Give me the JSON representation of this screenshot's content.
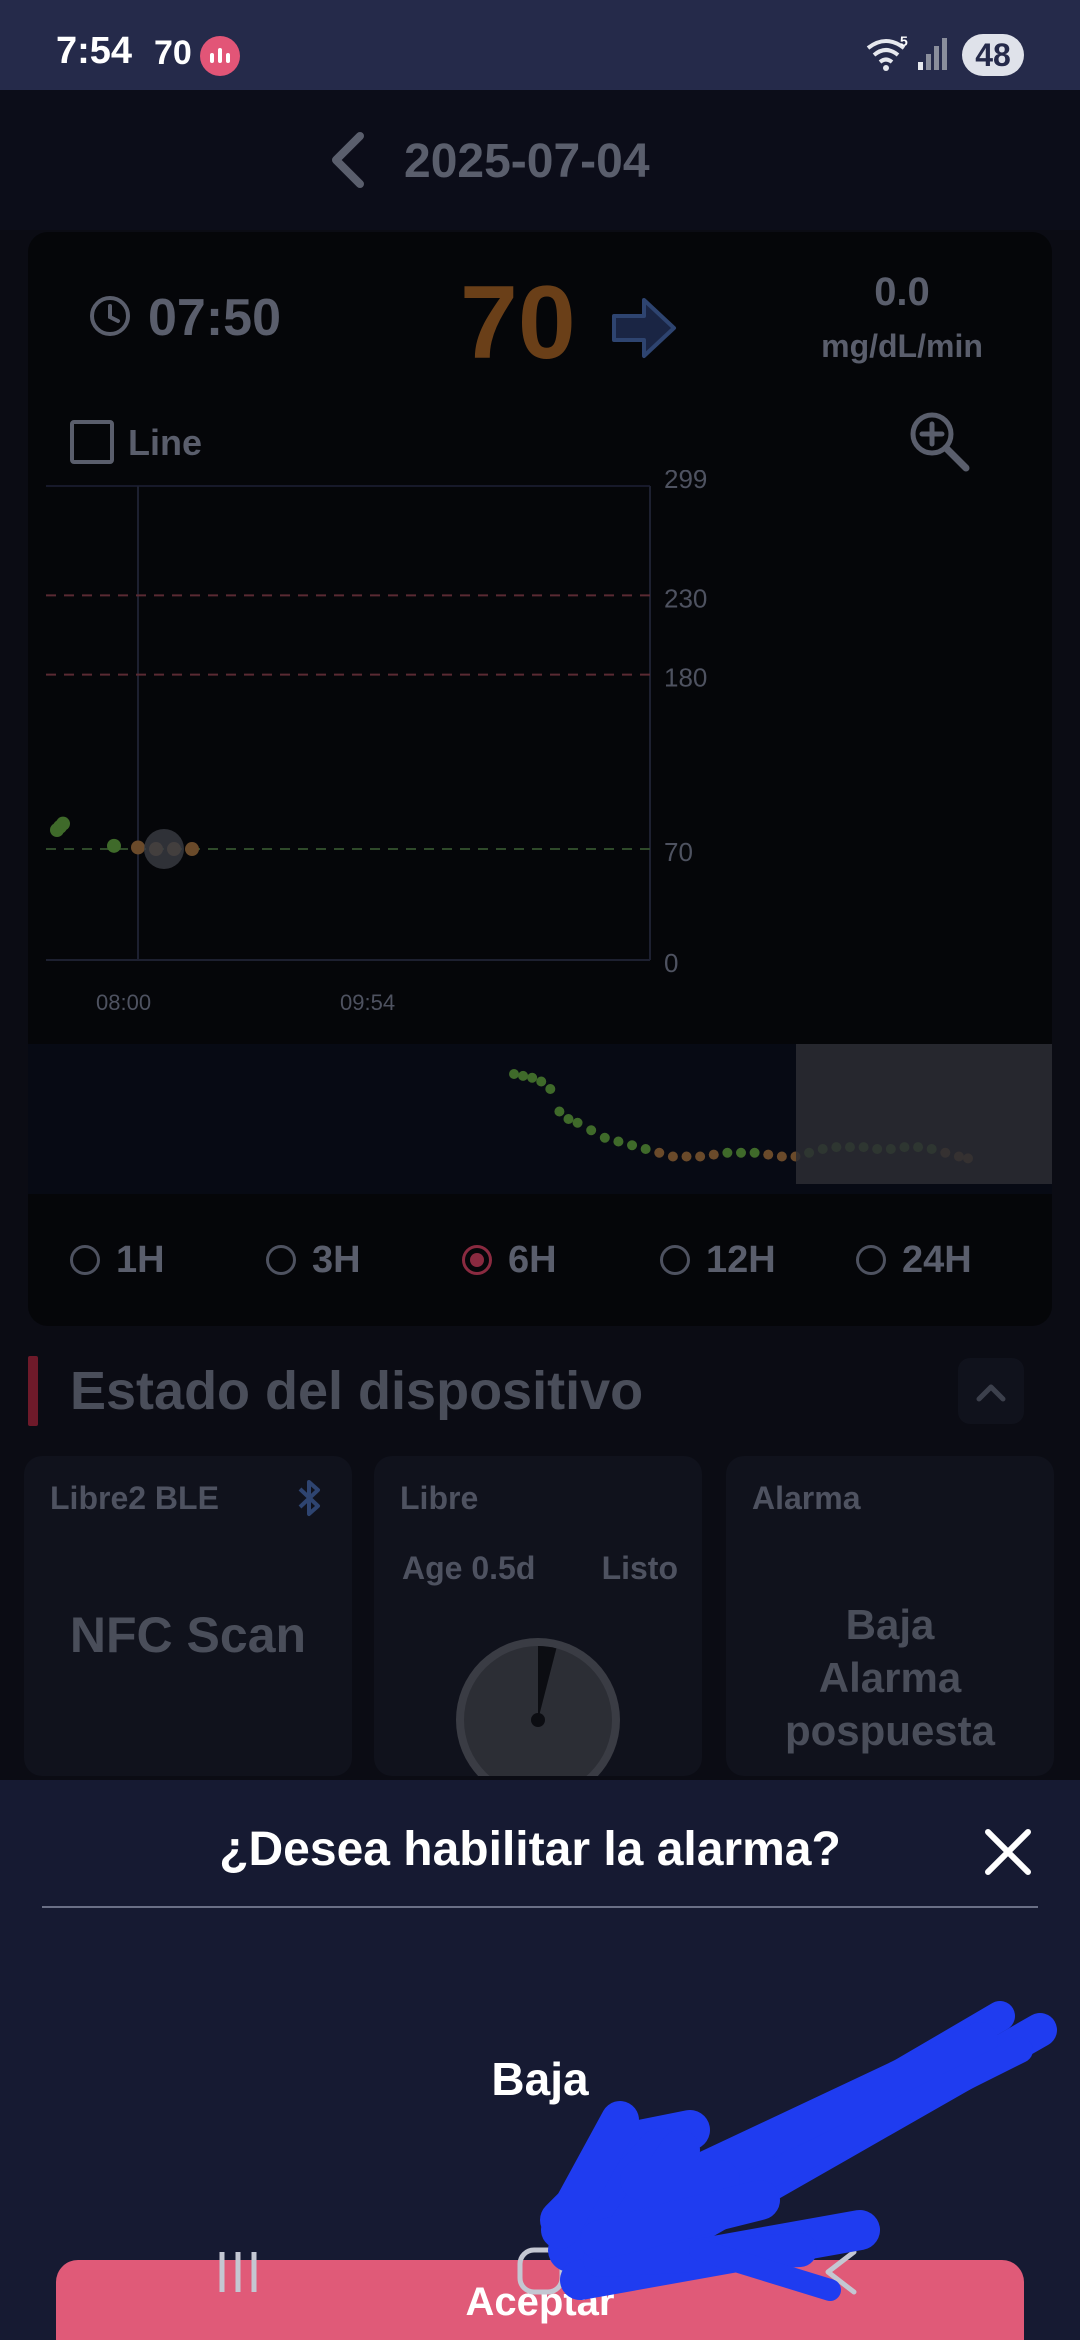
{
  "status_bar": {
    "time": "7:54",
    "glucose": "70",
    "battery": "48",
    "wifi_badge": "5",
    "icons": [
      "app-notification-icon",
      "wifi-icon",
      "signal-icon",
      "battery-icon"
    ]
  },
  "header": {
    "date": "2025-07-04",
    "back_icon": "chevron-left-icon"
  },
  "reading": {
    "time": "07:50",
    "value": "70",
    "value_color": "#6a3f18",
    "trend": "arrow-right",
    "rate": "0.0",
    "rate_unit": "mg/dL/min"
  },
  "chart_options": {
    "line_label": "Line",
    "line_checked": false
  },
  "chart_data": [
    {
      "type": "scatter",
      "x_tick_labels": [
        "08:00",
        "09:54"
      ],
      "y_tick_labels": [
        "299",
        "230",
        "180",
        "70",
        "0"
      ],
      "ylim": [
        0,
        299
      ],
      "thresholds": [
        {
          "value": 230,
          "color": "#5a2a33",
          "style": "dashed"
        },
        {
          "value": 180,
          "color": "#5a2a33",
          "style": "dashed"
        },
        {
          "value": 70,
          "color": "#2f4a2a",
          "style": "dashed"
        }
      ],
      "cursor_value": 70,
      "points": [
        {
          "x": -0.135,
          "y": 82,
          "color": "#3f6a2a"
        },
        {
          "x": -0.13,
          "y": 84,
          "color": "#3f6a2a"
        },
        {
          "x": -0.125,
          "y": 86,
          "color": "#3f6a2a"
        },
        {
          "x": -0.04,
          "y": 72,
          "color": "#3f6a2a"
        },
        {
          "x": 0.0,
          "y": 71,
          "color": "#6a4a2a"
        },
        {
          "x": 0.03,
          "y": 70,
          "color": "#6a4a2a"
        },
        {
          "x": 0.06,
          "y": 70,
          "color": "#6a4a2a"
        },
        {
          "x": 0.09,
          "y": 70,
          "color": "#6a4a2a"
        }
      ],
      "grid": false
    },
    {
      "type": "scatter",
      "role": "overview",
      "ylim": [
        0,
        299
      ],
      "points": [
        {
          "x": 0.0,
          "y": 124,
          "color": "#3f6a2a"
        },
        {
          "x": 0.02,
          "y": 123,
          "color": "#3f6a2a"
        },
        {
          "x": 0.04,
          "y": 122,
          "color": "#3f6a2a"
        },
        {
          "x": 0.06,
          "y": 120,
          "color": "#3f6a2a"
        },
        {
          "x": 0.08,
          "y": 116,
          "color": "#3f6a2a"
        },
        {
          "x": 0.1,
          "y": 104,
          "color": "#3f6a2a"
        },
        {
          "x": 0.12,
          "y": 100,
          "color": "#3f6a2a"
        },
        {
          "x": 0.14,
          "y": 98,
          "color": "#3f6a2a"
        },
        {
          "x": 0.17,
          "y": 94,
          "color": "#3f6a2a"
        },
        {
          "x": 0.2,
          "y": 90,
          "color": "#3f6a2a"
        },
        {
          "x": 0.23,
          "y": 88,
          "color": "#3f6a2a"
        },
        {
          "x": 0.26,
          "y": 86,
          "color": "#3f6a2a"
        },
        {
          "x": 0.29,
          "y": 84,
          "color": "#3f6a2a"
        },
        {
          "x": 0.32,
          "y": 82,
          "color": "#6a4a2a"
        },
        {
          "x": 0.35,
          "y": 80,
          "color": "#6a4a2a"
        },
        {
          "x": 0.38,
          "y": 80,
          "color": "#6a4a2a"
        },
        {
          "x": 0.41,
          "y": 80,
          "color": "#6a4a2a"
        },
        {
          "x": 0.44,
          "y": 81,
          "color": "#6a4a2a"
        },
        {
          "x": 0.47,
          "y": 82,
          "color": "#3f6a2a"
        },
        {
          "x": 0.5,
          "y": 82,
          "color": "#3f6a2a"
        },
        {
          "x": 0.53,
          "y": 82,
          "color": "#3f6a2a"
        },
        {
          "x": 0.56,
          "y": 81,
          "color": "#6a4a2a"
        },
        {
          "x": 0.59,
          "y": 80,
          "color": "#6a4a2a"
        },
        {
          "x": 0.62,
          "y": 80,
          "color": "#6a4a2a"
        },
        {
          "x": 0.65,
          "y": 82,
          "color": "#3f6a2a"
        },
        {
          "x": 0.68,
          "y": 84,
          "color": "#3f6a2a"
        },
        {
          "x": 0.71,
          "y": 85,
          "color": "#3f6a2a"
        },
        {
          "x": 0.74,
          "y": 85,
          "color": "#3f6a2a"
        },
        {
          "x": 0.77,
          "y": 85,
          "color": "#3f6a2a"
        },
        {
          "x": 0.8,
          "y": 84,
          "color": "#3f6a2a"
        },
        {
          "x": 0.83,
          "y": 84,
          "color": "#3f6a2a"
        },
        {
          "x": 0.86,
          "y": 85,
          "color": "#3f6a2a"
        },
        {
          "x": 0.89,
          "y": 85,
          "color": "#3f6a2a"
        },
        {
          "x": 0.92,
          "y": 84,
          "color": "#3f6a2a"
        },
        {
          "x": 0.95,
          "y": 82,
          "color": "#6a4a2a"
        },
        {
          "x": 0.98,
          "y": 80,
          "color": "#6a4a2a"
        },
        {
          "x": 1.0,
          "y": 79,
          "color": "#6a4a2a"
        }
      ],
      "selected_window": [
        0.78,
        1.0
      ]
    }
  ],
  "ranges": {
    "options": [
      "1H",
      "3H",
      "6H",
      "12H",
      "24H"
    ],
    "selected": "6H"
  },
  "device_status": {
    "title": "Estado del dispositivo",
    "sensor_card": {
      "title": "Libre2 BLE",
      "action": "NFC Scan",
      "icon": "bluetooth-icon"
    },
    "libre_card": {
      "title": "Libre",
      "age": "Age 0.5d",
      "state": "Listo",
      "elapsed_fraction": 0.04
    },
    "alarm_card": {
      "title": "Alarma",
      "state_lines": [
        "Baja",
        "Alarma",
        "pospuesta"
      ]
    }
  },
  "dialog": {
    "title": "¿Desea habilitar la alarma?",
    "value": "Baja",
    "accept_label": "Aceptar",
    "close_icon": "close-icon"
  },
  "navigation": {
    "icons": [
      "recents-icon",
      "home-icon",
      "back-icon"
    ]
  },
  "colors": {
    "accent": "#e05a78",
    "dialog_bg": "#161a32",
    "status_bar_bg": "#252a4a",
    "scribble": "#1f3cf0"
  }
}
